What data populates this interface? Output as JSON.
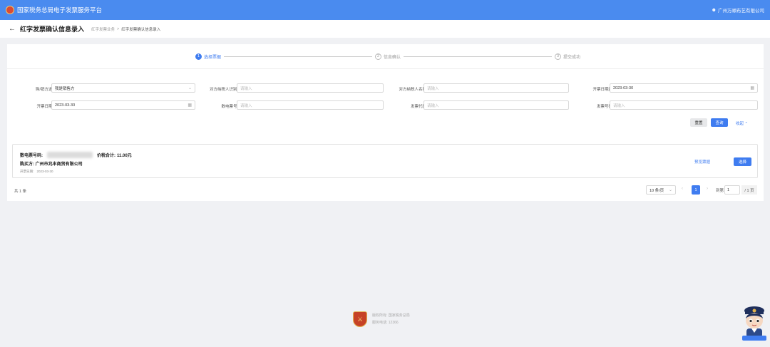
{
  "header": {
    "title": "国家税务总局电子发票服务平台",
    "company": "广州万顺布艺有限公司"
  },
  "subheader": {
    "page_title": "红字发票确认信息录入",
    "breadcrumb": [
      "红字发票业务",
      "红字发票确认信息录入"
    ]
  },
  "steps": [
    {
      "num": "1",
      "label": "选择票据"
    },
    {
      "num": "2",
      "label": "信息确认"
    },
    {
      "num": "3",
      "label": "提交成功"
    }
  ],
  "form": {
    "role_label": "购/销方选择",
    "role_value": "我是销售方",
    "taxpayer_id_label": "对方纳税人识别号",
    "taxpayer_name_label": "对方纳税人名称",
    "start_date_label": "开票日期起",
    "start_date_value": "2023-03-30",
    "end_date_label": "开票日期止",
    "end_date_value": "2023-03-30",
    "digital_no_label": "数电票号码",
    "invoice_code_label": "发票代码",
    "invoice_no_label": "发票号码",
    "placeholder": "请输入",
    "reset_label": "重置",
    "query_label": "查询",
    "collapse_label": "收起"
  },
  "invoice": {
    "digital_no_label": "数电票号码:",
    "total_label": "价税合计:",
    "total_value": "11.00元",
    "buyer_label": "购买方:",
    "buyer_value": "广州市兆丰商贸有限公司",
    "date_label": "开票日期:",
    "date_value": "2023-03-30",
    "preview_label": "预览票据",
    "select_label": "选择"
  },
  "pagination": {
    "total": "共 1 条",
    "page_size": "10 条/页",
    "current_page": "1",
    "goto_label": "到第",
    "goto_value": "1",
    "total_pages": "/ 1 页"
  },
  "footer": {
    "copyright": "版权所有: 国家税务总局",
    "phone": "服务电话: 12366"
  },
  "colors": {
    "header_bg": "#4a8bef",
    "primary": "#3f7cf0"
  }
}
